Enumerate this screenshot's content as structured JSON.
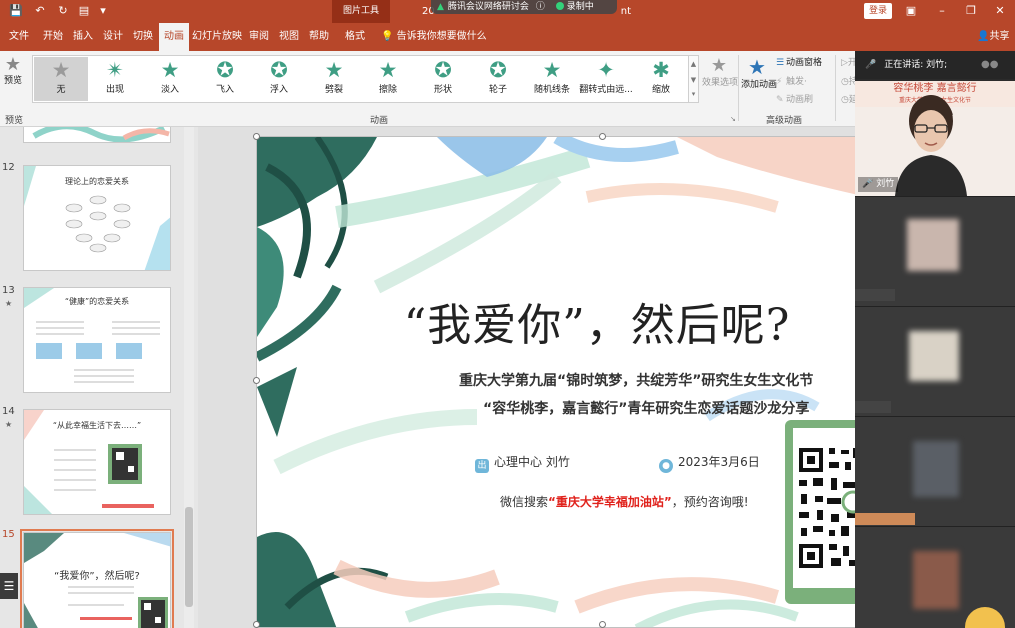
{
  "titlebar": {
    "context_tools": "图片工具",
    "doc_title": "20",
    "doc_ext": "nt",
    "meeting_name": "腾讯会议网络研讨会",
    "recording": "录制中",
    "login": "登录"
  },
  "tabs": [
    {
      "label": "文件",
      "id": "file"
    },
    {
      "label": "开始",
      "id": "home"
    },
    {
      "label": "插入",
      "id": "insert"
    },
    {
      "label": "设计",
      "id": "design"
    },
    {
      "label": "切换",
      "id": "transitions"
    },
    {
      "label": "动画",
      "id": "animations"
    },
    {
      "label": "幻灯片放映",
      "id": "slideshow"
    },
    {
      "label": "审阅",
      "id": "review"
    },
    {
      "label": "视图",
      "id": "view"
    },
    {
      "label": "帮助",
      "id": "help"
    },
    {
      "label": "格式",
      "id": "format"
    }
  ],
  "tell_me": "告诉我你想要做什么",
  "share": "共享",
  "ribbon": {
    "preview_label": "预览",
    "preview_group": "预览",
    "animations_group": "动画",
    "advanced_group": "高级动画",
    "animations": [
      {
        "label": "无",
        "icon": "star-none-icon"
      },
      {
        "label": "出现",
        "icon": "star-appear-icon"
      },
      {
        "label": "淡入",
        "icon": "star-fade-icon"
      },
      {
        "label": "飞入",
        "icon": "star-fly-icon"
      },
      {
        "label": "浮入",
        "icon": "star-float-icon"
      },
      {
        "label": "劈裂",
        "icon": "star-split-icon"
      },
      {
        "label": "擦除",
        "icon": "star-wipe-icon"
      },
      {
        "label": "形状",
        "icon": "star-shape-icon"
      },
      {
        "label": "轮子",
        "icon": "star-wheel-icon"
      },
      {
        "label": "随机线条",
        "icon": "star-random-bars-icon"
      },
      {
        "label": "翻转式由远...",
        "icon": "star-grow-turn-icon"
      },
      {
        "label": "缩放",
        "icon": "star-zoom-icon"
      }
    ],
    "effect_options": "效果选项",
    "add_animation": "添加动画",
    "animation_pane": "动画窗格",
    "trigger": "触发·",
    "anim_painter": "动画刷",
    "start": "开",
    "duration": "持",
    "delay": "延"
  },
  "thumbnails": [
    {
      "num": "12",
      "star": "",
      "title": "理论上的恋爱关系"
    },
    {
      "num": "13",
      "star": "★",
      "title": "“健康”的恋爱关系"
    },
    {
      "num": "14",
      "star": "★",
      "title": "“从此幸福生活下去……”"
    },
    {
      "num": "15",
      "star": "",
      "title": "“我爱你”，然后呢?"
    }
  ],
  "slide": {
    "title": "“我爱你”，然后呢?",
    "subtitle1": "重庆大学第九届“锦时筑梦，共绽芳华”研究生女生文化节",
    "subtitle2": "“容华桃李，嘉言懿行”青年研究生恋爱话题沙龙分享",
    "org": "心理中心  刘竹",
    "org_badge": "出",
    "date": "2023年3月6日",
    "wx_prefix": "微信搜索",
    "wx_highlight": "“重庆大学幸福加油站”",
    "wx_suffix": "，预约咨询哦!"
  },
  "video": {
    "speaking_label": "正在讲话: 刘竹;",
    "speaker_name": "刘竹",
    "speaker_banner": "容华桃李  嘉言懿行",
    "speaker_banner2": "重庆大学研究生女生文化节"
  },
  "colors": {
    "accent": "#b7472a",
    "anim_green": "#3f9e84",
    "highlight_red": "#e0211b",
    "qr_green": "#7bb07b"
  }
}
